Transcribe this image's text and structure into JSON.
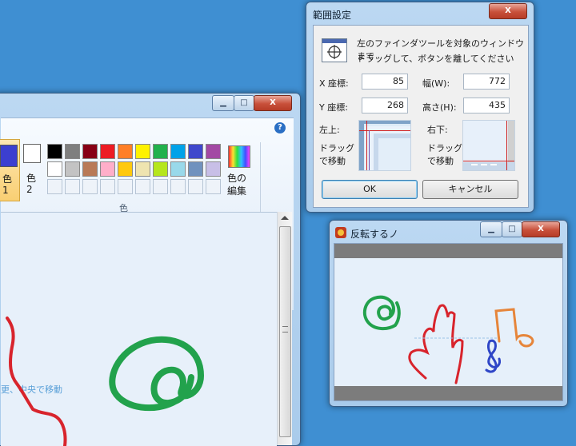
{
  "paint": {
    "ribbon": {
      "color1_label": "色",
      "color1_num": "1",
      "color2_label": "色",
      "color2_num": "2",
      "edit_colors_line1": "色の",
      "edit_colors_line2": "編集",
      "group_label": "色",
      "help_icon": "?"
    },
    "controls": {
      "minimize": "▁",
      "maximize": "□",
      "close": "X"
    },
    "canvas_text": "更、中央で移動",
    "colors": {
      "active_color1": "#3c3fd0",
      "row1": [
        "#000000",
        "#7f7f7f",
        "#880015",
        "#ed1c24",
        "#ff7f27",
        "#fff200",
        "#22b14c",
        "#00a2e8",
        "#3f48cc",
        "#a349a4"
      ],
      "row2": [
        "#ffffff",
        "#c3c3c3",
        "#b97a57",
        "#ffaec9",
        "#ffc90e",
        "#efe4b0",
        "#b5e61d",
        "#99d9ea",
        "#7092be",
        "#c8bfe7"
      ]
    }
  },
  "dialog": {
    "title": "範囲設定",
    "close": "X",
    "instruction_line1": "左のファインダツールを対象のウィンドウまで",
    "instruction_line2": "ドラッグして、ボタンを離してください",
    "x_label": "X 座標:",
    "x_value": "85",
    "w_label": "幅(W):",
    "w_value": "772",
    "y_label": "Y 座標:",
    "y_value": "268",
    "h_label": "高さ(H):",
    "h_value": "435",
    "top_left_label": "左上:",
    "bottom_right_label": "右下:",
    "drag_line1": "ドラッグ",
    "drag_line2": "で移動",
    "ok": "OK",
    "cancel": "キャンセル"
  },
  "flip": {
    "title": "反転するノ",
    "controls": {
      "minimize": "▁",
      "maximize": "□",
      "close": "X"
    }
  }
}
